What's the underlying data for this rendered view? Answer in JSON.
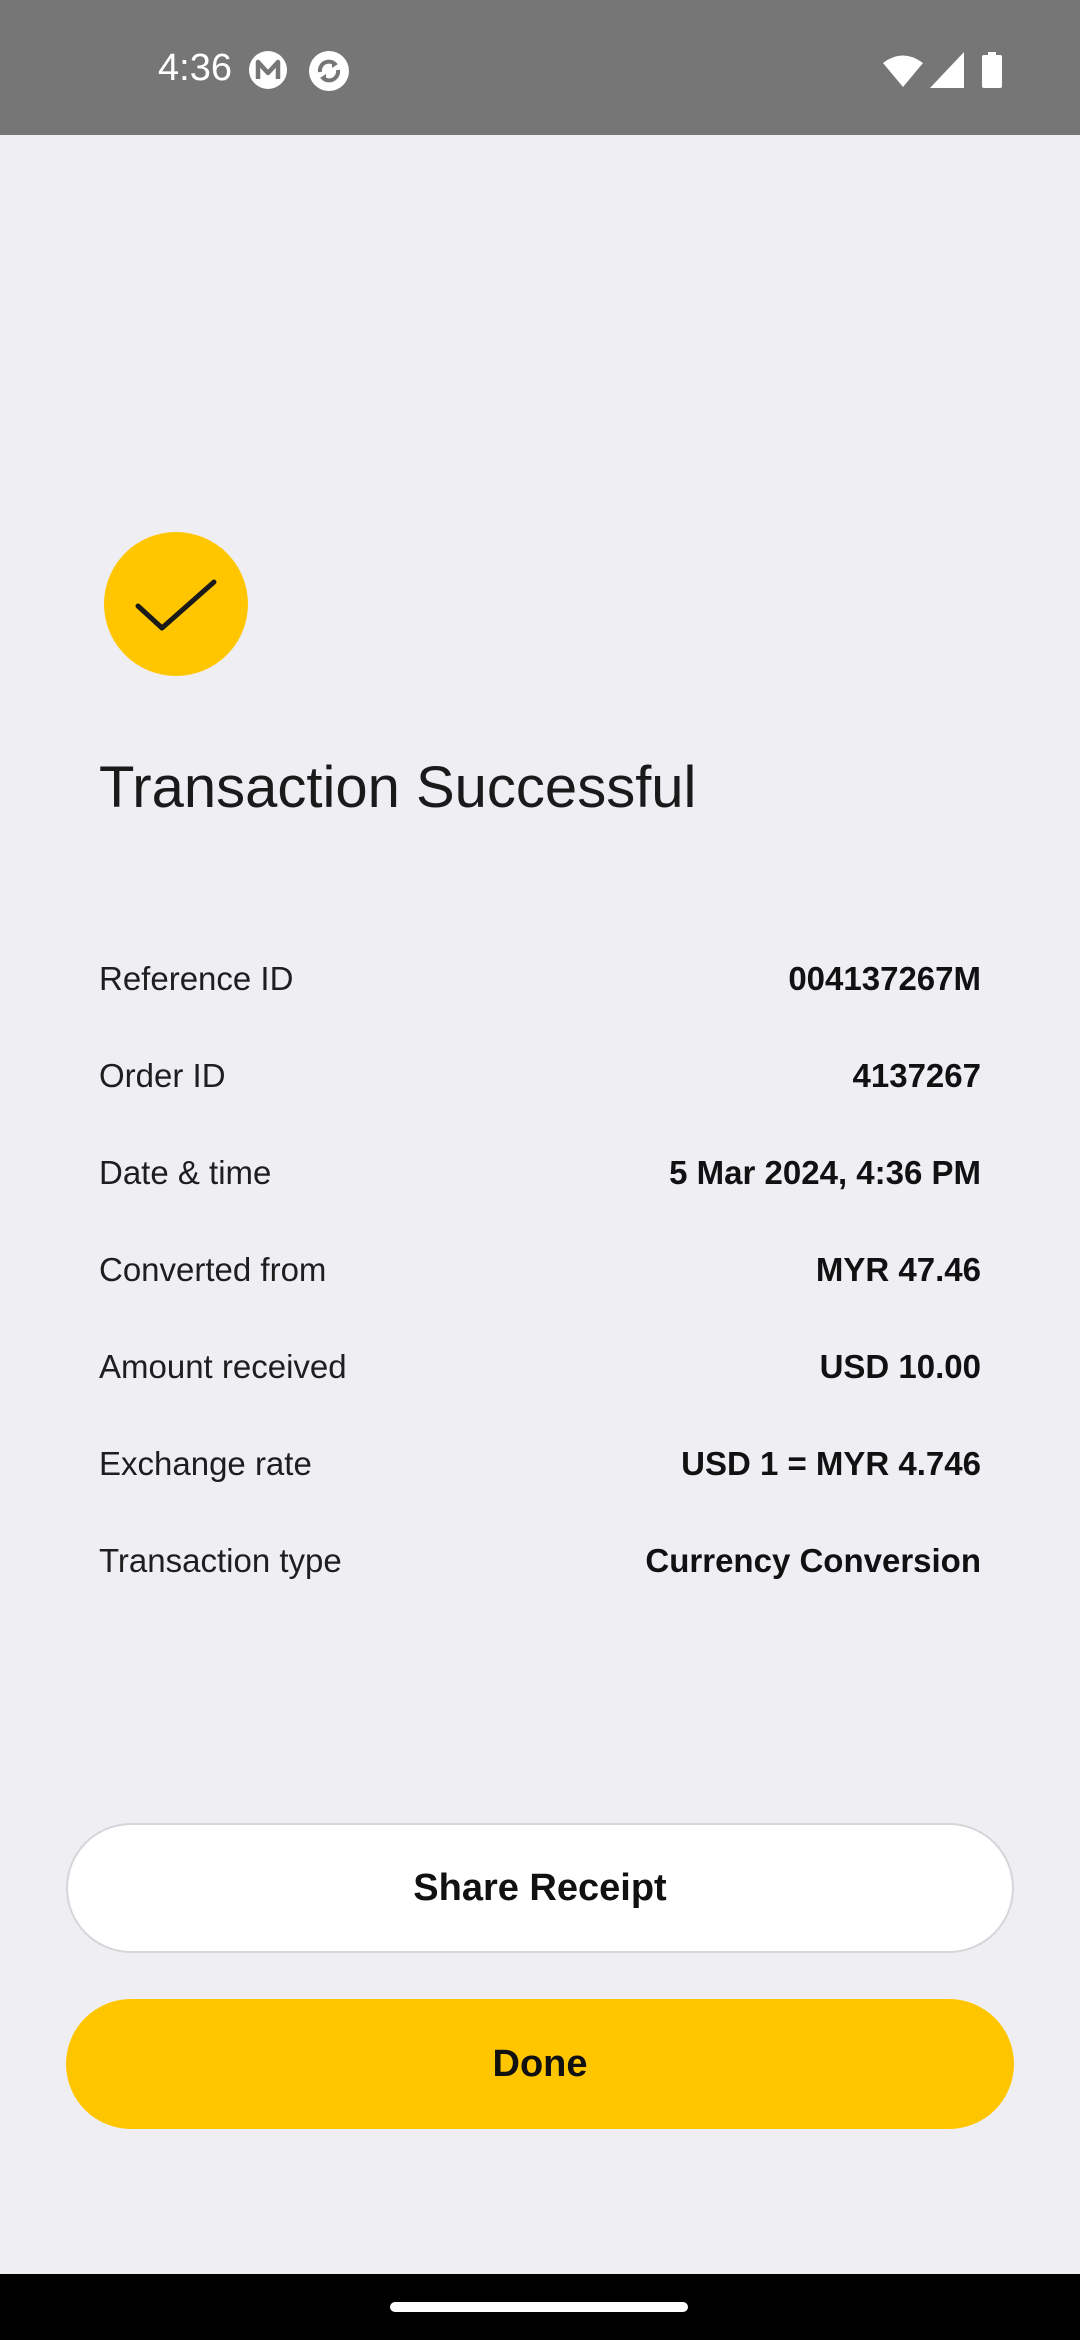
{
  "status_bar": {
    "time": "4:36",
    "icons": [
      "m-app-icon",
      "sync-icon",
      "wifi-icon",
      "signal-icon",
      "battery-icon"
    ]
  },
  "colors": {
    "accent": "#ffc600",
    "background": "#efeef3",
    "status_bar": "#767676"
  },
  "success": {
    "icon": "checkmark-icon",
    "title": "Transaction Successful"
  },
  "details": [
    {
      "label": "Reference ID",
      "value": "004137267M"
    },
    {
      "label": "Order ID",
      "value": "4137267"
    },
    {
      "label": "Date & time",
      "value": "5 Mar 2024, 4:36 PM"
    },
    {
      "label": "Converted from",
      "value": "MYR 47.46"
    },
    {
      "label": "Amount received",
      "value": "USD 10.00"
    },
    {
      "label": "Exchange rate",
      "value": "USD 1 = MYR 4.746"
    },
    {
      "label": "Transaction type",
      "value": "Currency Conversion"
    }
  ],
  "actions": {
    "share_label": "Share Receipt",
    "done_label": "Done"
  }
}
